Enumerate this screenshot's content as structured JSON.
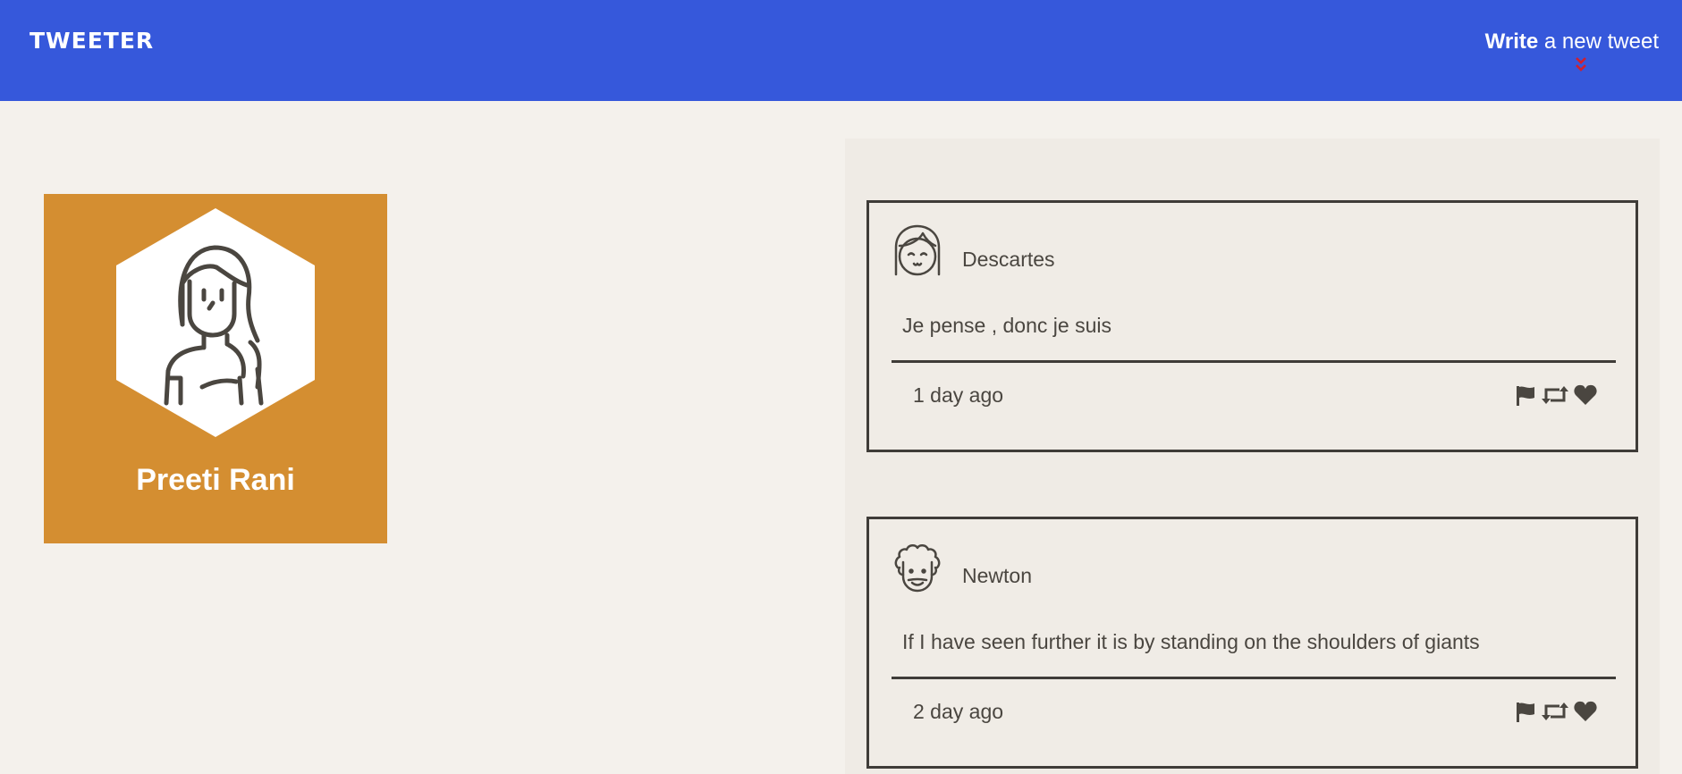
{
  "navbar": {
    "logo": "TWEETER",
    "write_bold": "Write",
    "write_rest": " a new tweet",
    "accent_color": "#3658db",
    "arrow_color": "#d21f2c"
  },
  "profile": {
    "name": "Preeti Rani",
    "card_color": "#d48e31"
  },
  "tweets": [
    {
      "author": "Descartes",
      "content": "Je pense , donc je suis",
      "time": "1 day ago",
      "avatar_icon": "girl-face-icon"
    },
    {
      "author": "Newton",
      "content": "If I have seen further it is by standing on the shoulders of giants",
      "time": "2 day ago",
      "avatar_icon": "curly-hair-face-icon"
    }
  ],
  "actions": [
    "flag-icon",
    "retweet-icon",
    "heart-icon"
  ]
}
